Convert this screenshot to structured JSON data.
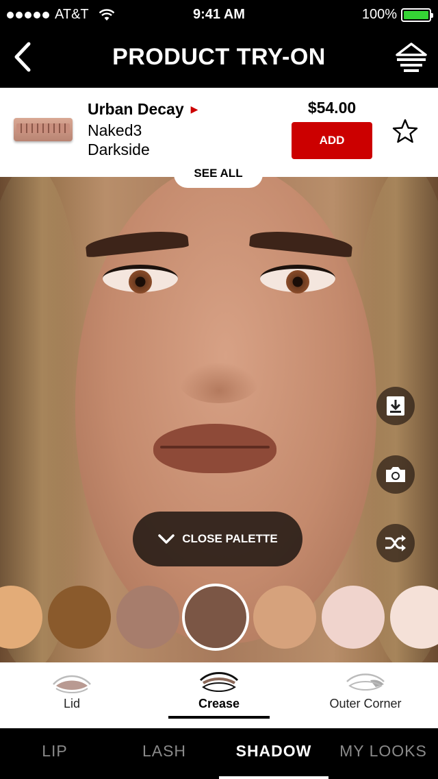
{
  "status_bar": {
    "carrier": "AT&T",
    "time": "9:41 AM",
    "battery": "100%"
  },
  "header": {
    "title": "PRODUCT TRY-ON",
    "back_icon": "chevron-left-icon",
    "filter_icon": "filter-icon"
  },
  "product": {
    "brand": "Urban Decay",
    "name_line1": "Naked3",
    "name_line2": "Darkside",
    "price": "$54.00",
    "add_label": "ADD",
    "accent": "#cc0000"
  },
  "photo": {
    "see_all_label": "SEE ALL",
    "close_palette_label": "CLOSE PALETTE",
    "side_icons": [
      "save-icon",
      "camera-icon",
      "shuffle-icon"
    ]
  },
  "swatches": [
    {
      "color": "#e3ac78"
    },
    {
      "color": "#8a5a2c"
    },
    {
      "color": "#a77d6c"
    },
    {
      "color": "#7b5645",
      "selected": true
    },
    {
      "color": "#d6a27c"
    },
    {
      "color": "#f0d4cd"
    },
    {
      "color": "#f5e1d8"
    }
  ],
  "areas": [
    {
      "label": "Lid"
    },
    {
      "label": "Crease",
      "active": true
    },
    {
      "label": "Outer Corner"
    }
  ],
  "tabs": [
    {
      "label": "LIP"
    },
    {
      "label": "LASH"
    },
    {
      "label": "SHADOW",
      "active": true
    },
    {
      "label": "MY LOOKS"
    }
  ]
}
